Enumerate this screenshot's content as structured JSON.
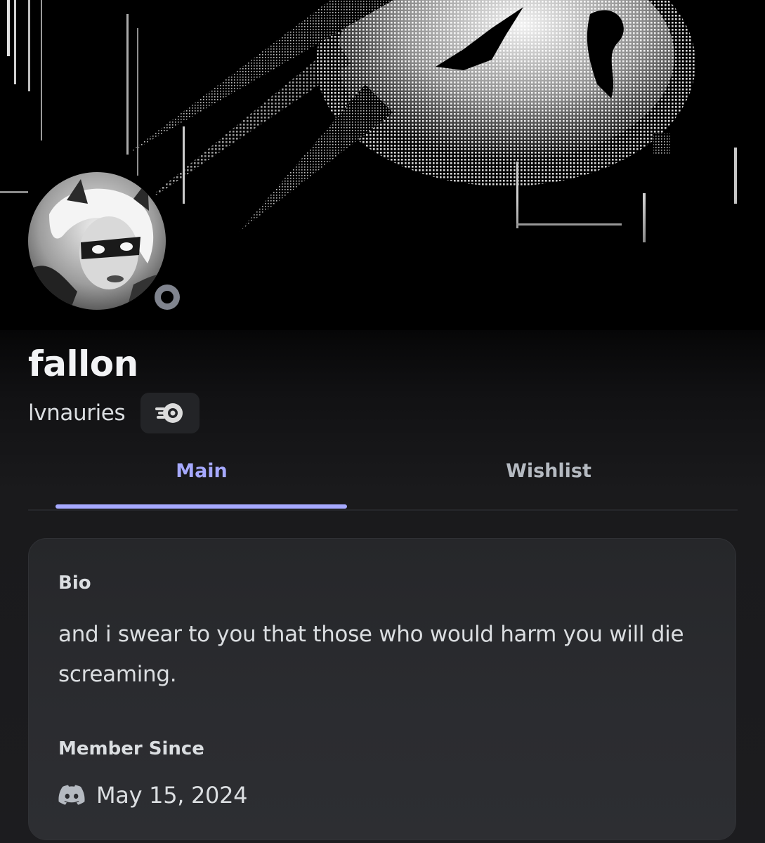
{
  "profile": {
    "display_name": "fallon",
    "username": "lvnauries",
    "status": "offline",
    "badge_icon": "nitro-badge-icon"
  },
  "tabs": [
    {
      "label": "Main",
      "active": true
    },
    {
      "label": "Wishlist",
      "active": false
    }
  ],
  "bio": {
    "title": "Bio",
    "text": "and i swear to you that those who would harm you will die screaming."
  },
  "member_since": {
    "title": "Member Since",
    "date": "May 15, 2024",
    "icon": "discord-icon"
  },
  "colors": {
    "accent": "#a6a9ff",
    "status_offline": "#80848e",
    "card_bg": "#2b2c30",
    "page_bg": "#000000"
  }
}
